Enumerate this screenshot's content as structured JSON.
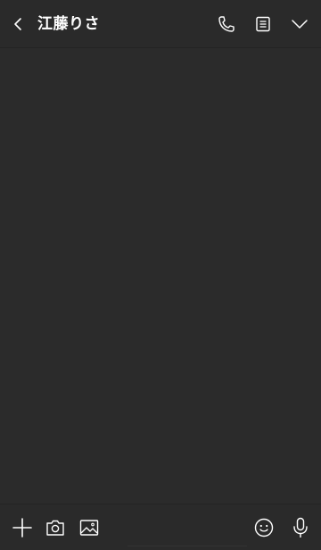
{
  "header": {
    "title": "江藤りさ",
    "icons": {
      "back": "chevron-left-icon",
      "call": "phone-icon",
      "note": "note-icon",
      "menu": "chevron-down-icon"
    }
  },
  "composer": {
    "placeholder": "",
    "icons": {
      "plus": "plus-icon",
      "camera": "camera-icon",
      "image": "image-icon",
      "emoji": "emoji-icon",
      "mic": "microphone-icon"
    }
  },
  "colors": {
    "background": "#2b2b2b",
    "bar": "#2a2a2a",
    "icon": "#ffffff"
  }
}
